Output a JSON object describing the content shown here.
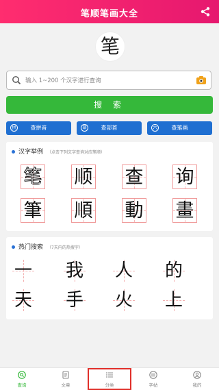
{
  "header": {
    "title": "笔顺笔画大全"
  },
  "logo": {
    "char": "笔"
  },
  "search": {
    "placeholder": "输入 1~200 个汉字进行查询",
    "button_label": "搜 索"
  },
  "quick_buttons": [
    {
      "label": "查拼音",
      "icon_text": "拼"
    },
    {
      "label": "查部首",
      "icon_text": "部"
    },
    {
      "label": "查笔画",
      "icon_text": "六"
    }
  ],
  "examples": {
    "title": "汉字举例",
    "note": "（点击下列文字查询对应笔顺）",
    "chars": [
      "笔",
      "顺",
      "查",
      "询",
      "筆",
      "順",
      "動",
      "畫"
    ]
  },
  "hot": {
    "title": "热门搜索",
    "note": "（7天内的热搜字）",
    "chars": [
      "一",
      "我",
      "人",
      "的",
      "天",
      "手",
      "火",
      "上"
    ]
  },
  "tabs": [
    {
      "label": "查询",
      "icon": "search-circle-icon"
    },
    {
      "label": "文章",
      "icon": "document-icon"
    },
    {
      "label": "分类",
      "icon": "list-icon"
    },
    {
      "label": "字帖",
      "icon": "copybook-icon"
    },
    {
      "label": "我的",
      "icon": "user-icon"
    }
  ],
  "colors": {
    "brand": "#ff2d6f",
    "accent_green": "#35b83a",
    "blue": "#1f6fd1",
    "grid_red": "#f09a9a"
  }
}
